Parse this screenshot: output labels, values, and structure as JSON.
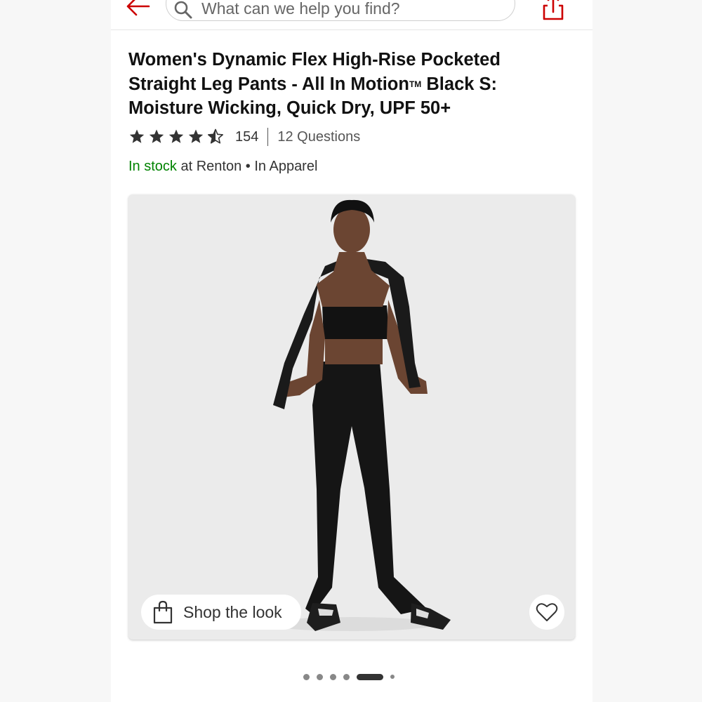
{
  "search": {
    "placeholder": "What can we help you find?"
  },
  "product": {
    "title_part1": "Women's Dynamic Flex High-Rise Pocketed Straight Leg Pants - All In Motion",
    "tm": "TM",
    "title_part2": " Black S: Moisture Wicking, Quick Dry, UPF 50+",
    "rating": 4.5,
    "review_count": "154",
    "questions": "12 Questions"
  },
  "stock": {
    "status": "In stock",
    "location": " at Renton",
    "separator": " • ",
    "department": "In Apparel"
  },
  "gallery": {
    "shop_the_look": "Shop the look",
    "slide_count": 6,
    "active_slide": 5
  },
  "colors": {
    "accent": "#cc0000",
    "in_stock": "#008300",
    "text": "#111111"
  },
  "icons": [
    "back-arrow-icon",
    "search-icon",
    "share-icon",
    "star-icon",
    "star-half-icon",
    "shopping-bag-icon",
    "heart-icon"
  ]
}
